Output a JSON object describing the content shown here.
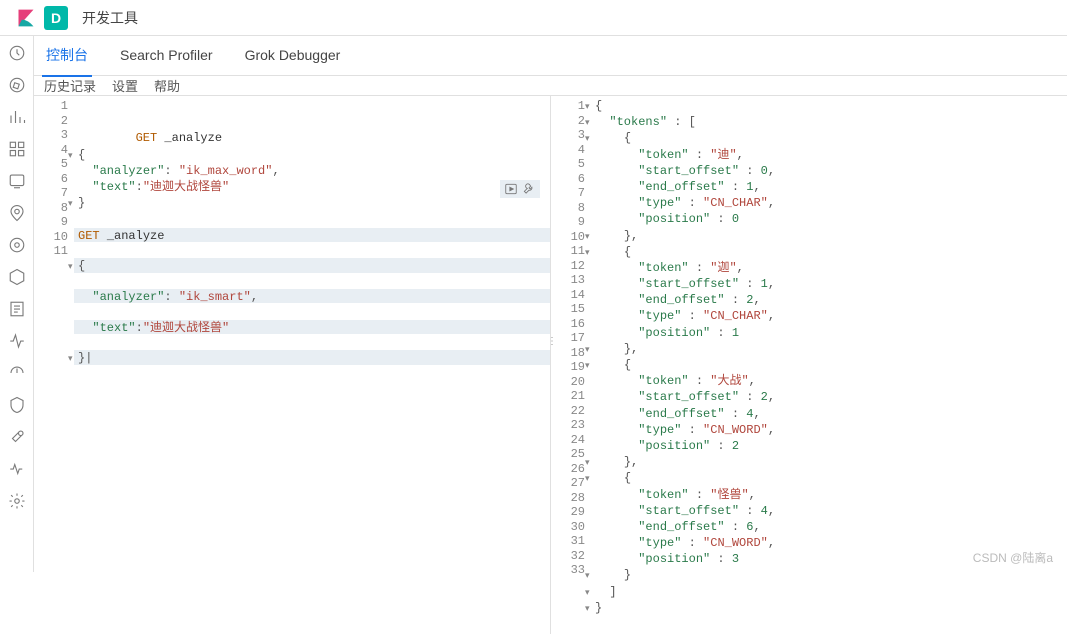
{
  "header": {
    "badge": "D",
    "breadcrumb": "开发工具"
  },
  "tabs": {
    "items": [
      {
        "label": "控制台",
        "active": true
      },
      {
        "label": "Search Profiler",
        "active": false
      },
      {
        "label": "Grok Debugger",
        "active": false
      }
    ]
  },
  "subbar": {
    "history": "历史记录",
    "settings": "设置",
    "help": "帮助"
  },
  "left_editor": {
    "lines": [
      {
        "num": "1",
        "fold": "",
        "parts": [
          [
            "method",
            "GET "
          ],
          [
            "plain",
            "_analyze"
          ]
        ],
        "hl": false
      },
      {
        "num": "2",
        "fold": "▾",
        "parts": [
          [
            "punct",
            "{"
          ]
        ],
        "hl": false
      },
      {
        "num": "3",
        "fold": "",
        "parts": [
          [
            "plain",
            "  "
          ],
          [
            "key",
            "\"analyzer\""
          ],
          [
            "punct",
            ": "
          ],
          [
            "str",
            "\"ik_max_word\""
          ],
          [
            "punct",
            ","
          ]
        ],
        "hl": false
      },
      {
        "num": "4",
        "fold": "",
        "parts": [
          [
            "plain",
            "  "
          ],
          [
            "key",
            "\"text\""
          ],
          [
            "punct",
            ":"
          ],
          [
            "str",
            "\"迪迦大战怪兽\""
          ]
        ],
        "hl": false
      },
      {
        "num": "5",
        "fold": "▾",
        "parts": [
          [
            "punct",
            "}"
          ]
        ],
        "hl": false
      },
      {
        "num": "6",
        "fold": "",
        "parts": [
          [
            "plain",
            ""
          ]
        ],
        "hl": false
      },
      {
        "num": "7",
        "fold": "",
        "parts": [
          [
            "method",
            "GET "
          ],
          [
            "plain",
            "_analyze"
          ]
        ],
        "hl": true
      },
      {
        "num": "8",
        "fold": "▾",
        "parts": [
          [
            "punct",
            "{"
          ]
        ],
        "hl": true
      },
      {
        "num": "9",
        "fold": "",
        "parts": [
          [
            "plain",
            "  "
          ],
          [
            "key",
            "\"analyzer\""
          ],
          [
            "punct",
            ": "
          ],
          [
            "str",
            "\"ik_smart\""
          ],
          [
            "punct",
            ","
          ]
        ],
        "hl": true
      },
      {
        "num": "10",
        "fold": "",
        "parts": [
          [
            "plain",
            "  "
          ],
          [
            "key",
            "\"text\""
          ],
          [
            "punct",
            ":"
          ],
          [
            "str",
            "\"迪迦大战怪兽\""
          ]
        ],
        "hl": true
      },
      {
        "num": "11",
        "fold": "▾",
        "parts": [
          [
            "punct",
            "}|"
          ]
        ],
        "hl": true
      }
    ]
  },
  "right_editor": {
    "lines": [
      {
        "num": "1",
        "fold": "▾",
        "parts": [
          [
            "punct",
            "{"
          ]
        ]
      },
      {
        "num": "2",
        "fold": "▾",
        "parts": [
          [
            "plain",
            "  "
          ],
          [
            "key",
            "\"tokens\""
          ],
          [
            "punct",
            " : ["
          ]
        ]
      },
      {
        "num": "3",
        "fold": "▾",
        "parts": [
          [
            "plain",
            "    "
          ],
          [
            "punct",
            "{"
          ]
        ]
      },
      {
        "num": "4",
        "fold": "",
        "parts": [
          [
            "plain",
            "      "
          ],
          [
            "key",
            "\"token\""
          ],
          [
            "punct",
            " : "
          ],
          [
            "str",
            "\"迪\""
          ],
          [
            "punct",
            ","
          ]
        ]
      },
      {
        "num": "5",
        "fold": "",
        "parts": [
          [
            "plain",
            "      "
          ],
          [
            "key",
            "\"start_offset\""
          ],
          [
            "punct",
            " : "
          ],
          [
            "num",
            "0"
          ],
          [
            "punct",
            ","
          ]
        ]
      },
      {
        "num": "6",
        "fold": "",
        "parts": [
          [
            "plain",
            "      "
          ],
          [
            "key",
            "\"end_offset\""
          ],
          [
            "punct",
            " : "
          ],
          [
            "num",
            "1"
          ],
          [
            "punct",
            ","
          ]
        ]
      },
      {
        "num": "7",
        "fold": "",
        "parts": [
          [
            "plain",
            "      "
          ],
          [
            "key",
            "\"type\""
          ],
          [
            "punct",
            " : "
          ],
          [
            "str",
            "\"CN_CHAR\""
          ],
          [
            "punct",
            ","
          ]
        ]
      },
      {
        "num": "8",
        "fold": "",
        "parts": [
          [
            "plain",
            "      "
          ],
          [
            "key",
            "\"position\""
          ],
          [
            "punct",
            " : "
          ],
          [
            "num",
            "0"
          ]
        ]
      },
      {
        "num": "9",
        "fold": "▾",
        "parts": [
          [
            "plain",
            "    "
          ],
          [
            "punct",
            "},"
          ]
        ]
      },
      {
        "num": "10",
        "fold": "▾",
        "parts": [
          [
            "plain",
            "    "
          ],
          [
            "punct",
            "{"
          ]
        ]
      },
      {
        "num": "11",
        "fold": "",
        "parts": [
          [
            "plain",
            "      "
          ],
          [
            "key",
            "\"token\""
          ],
          [
            "punct",
            " : "
          ],
          [
            "str",
            "\"迦\""
          ],
          [
            "punct",
            ","
          ]
        ]
      },
      {
        "num": "12",
        "fold": "",
        "parts": [
          [
            "plain",
            "      "
          ],
          [
            "key",
            "\"start_offset\""
          ],
          [
            "punct",
            " : "
          ],
          [
            "num",
            "1"
          ],
          [
            "punct",
            ","
          ]
        ]
      },
      {
        "num": "13",
        "fold": "",
        "parts": [
          [
            "plain",
            "      "
          ],
          [
            "key",
            "\"end_offset\""
          ],
          [
            "punct",
            " : "
          ],
          [
            "num",
            "2"
          ],
          [
            "punct",
            ","
          ]
        ]
      },
      {
        "num": "14",
        "fold": "",
        "parts": [
          [
            "plain",
            "      "
          ],
          [
            "key",
            "\"type\""
          ],
          [
            "punct",
            " : "
          ],
          [
            "str",
            "\"CN_CHAR\""
          ],
          [
            "punct",
            ","
          ]
        ]
      },
      {
        "num": "15",
        "fold": "",
        "parts": [
          [
            "plain",
            "      "
          ],
          [
            "key",
            "\"position\""
          ],
          [
            "punct",
            " : "
          ],
          [
            "num",
            "1"
          ]
        ]
      },
      {
        "num": "16",
        "fold": "▾",
        "parts": [
          [
            "plain",
            "    "
          ],
          [
            "punct",
            "},"
          ]
        ]
      },
      {
        "num": "17",
        "fold": "▾",
        "parts": [
          [
            "plain",
            "    "
          ],
          [
            "punct",
            "{"
          ]
        ]
      },
      {
        "num": "18",
        "fold": "",
        "parts": [
          [
            "plain",
            "      "
          ],
          [
            "key",
            "\"token\""
          ],
          [
            "punct",
            " : "
          ],
          [
            "str",
            "\"大战\""
          ],
          [
            "punct",
            ","
          ]
        ]
      },
      {
        "num": "19",
        "fold": "",
        "parts": [
          [
            "plain",
            "      "
          ],
          [
            "key",
            "\"start_offset\""
          ],
          [
            "punct",
            " : "
          ],
          [
            "num",
            "2"
          ],
          [
            "punct",
            ","
          ]
        ]
      },
      {
        "num": "20",
        "fold": "",
        "parts": [
          [
            "plain",
            "      "
          ],
          [
            "key",
            "\"end_offset\""
          ],
          [
            "punct",
            " : "
          ],
          [
            "num",
            "4"
          ],
          [
            "punct",
            ","
          ]
        ]
      },
      {
        "num": "21",
        "fold": "",
        "parts": [
          [
            "plain",
            "      "
          ],
          [
            "key",
            "\"type\""
          ],
          [
            "punct",
            " : "
          ],
          [
            "str",
            "\"CN_WORD\""
          ],
          [
            "punct",
            ","
          ]
        ]
      },
      {
        "num": "22",
        "fold": "",
        "parts": [
          [
            "plain",
            "      "
          ],
          [
            "key",
            "\"position\""
          ],
          [
            "punct",
            " : "
          ],
          [
            "num",
            "2"
          ]
        ]
      },
      {
        "num": "23",
        "fold": "▾",
        "parts": [
          [
            "plain",
            "    "
          ],
          [
            "punct",
            "},"
          ]
        ]
      },
      {
        "num": "24",
        "fold": "▾",
        "parts": [
          [
            "plain",
            "    "
          ],
          [
            "punct",
            "{"
          ]
        ]
      },
      {
        "num": "25",
        "fold": "",
        "parts": [
          [
            "plain",
            "      "
          ],
          [
            "key",
            "\"token\""
          ],
          [
            "punct",
            " : "
          ],
          [
            "str",
            "\"怪兽\""
          ],
          [
            "punct",
            ","
          ]
        ]
      },
      {
        "num": "26",
        "fold": "",
        "parts": [
          [
            "plain",
            "      "
          ],
          [
            "key",
            "\"start_offset\""
          ],
          [
            "punct",
            " : "
          ],
          [
            "num",
            "4"
          ],
          [
            "punct",
            ","
          ]
        ]
      },
      {
        "num": "27",
        "fold": "",
        "parts": [
          [
            "plain",
            "      "
          ],
          [
            "key",
            "\"end_offset\""
          ],
          [
            "punct",
            " : "
          ],
          [
            "num",
            "6"
          ],
          [
            "punct",
            ","
          ]
        ]
      },
      {
        "num": "28",
        "fold": "",
        "parts": [
          [
            "plain",
            "      "
          ],
          [
            "key",
            "\"type\""
          ],
          [
            "punct",
            " : "
          ],
          [
            "str",
            "\"CN_WORD\""
          ],
          [
            "punct",
            ","
          ]
        ]
      },
      {
        "num": "29",
        "fold": "",
        "parts": [
          [
            "plain",
            "      "
          ],
          [
            "key",
            "\"position\""
          ],
          [
            "punct",
            " : "
          ],
          [
            "num",
            "3"
          ]
        ]
      },
      {
        "num": "30",
        "fold": "▾",
        "parts": [
          [
            "plain",
            "    "
          ],
          [
            "punct",
            "}"
          ]
        ]
      },
      {
        "num": "31",
        "fold": "▾",
        "parts": [
          [
            "plain",
            "  "
          ],
          [
            "punct",
            "]"
          ]
        ]
      },
      {
        "num": "32",
        "fold": "▾",
        "parts": [
          [
            "punct",
            "}"
          ]
        ]
      },
      {
        "num": "33",
        "fold": "",
        "parts": [
          [
            "plain",
            ""
          ]
        ]
      }
    ]
  },
  "watermark": "CSDN @陆离a"
}
